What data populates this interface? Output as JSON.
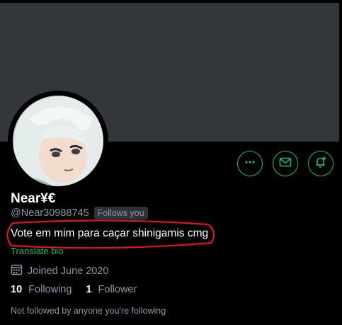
{
  "profile": {
    "display_name": "Near¥€",
    "handle": "@Near30988745",
    "follows_you_badge": "Follows you",
    "bio": "Vote em mim para caçar shinigamis cmg",
    "translate_label": "Translate bio",
    "joined": "Joined June 2020",
    "following_count": "10",
    "following_label": "Following",
    "followers_count": "1",
    "followers_label": "Follower",
    "mutuals_note": "Not followed by anyone you're following"
  },
  "icons": {
    "more": "more-icon",
    "message": "envelope-icon",
    "notify": "bell-plus-icon",
    "calendar": "calendar-icon"
  },
  "colors": {
    "accent": "#17bf63",
    "banner": "#33373b",
    "background": "#000000",
    "muted_text": "#8899a6",
    "annotation": "#e0141e"
  }
}
